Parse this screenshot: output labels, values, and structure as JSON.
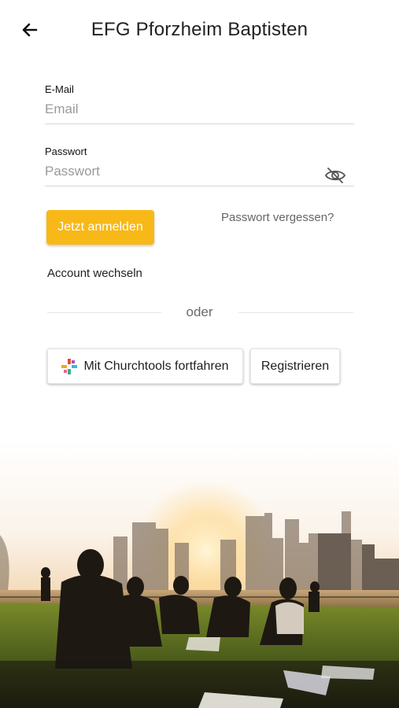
{
  "header": {
    "title": "EFG Pforzheim Baptisten",
    "back_icon": "arrow-left-icon"
  },
  "form": {
    "email": {
      "label": "E-Mail",
      "placeholder": "Email",
      "value": ""
    },
    "password": {
      "label": "Passwort",
      "placeholder": "Passwort",
      "value": "",
      "visibility_icon": "eye-off-icon"
    }
  },
  "actions": {
    "login_label": "Jetzt anmelden",
    "forgot_label": "Passwort vergessen?",
    "switch_account_label": "Account wechseln",
    "divider_label": "oder",
    "churchtools_label": "Mit Churchtools fortfahren",
    "churchtools_icon": "churchtools-logo-icon",
    "register_label": "Registrieren"
  },
  "colors": {
    "accent": "#f8b817",
    "text": "#1f1f1f",
    "muted": "#6a6a6a"
  },
  "hero": {
    "description_icon": "city-skyline-picnic-image"
  }
}
